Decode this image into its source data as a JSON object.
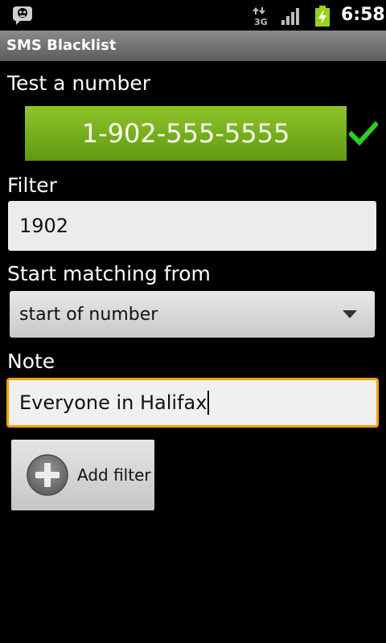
{
  "status_bar": {
    "time": "6:58",
    "network_type": "3G",
    "icons": [
      "app-notification-icon",
      "network-3g-icon",
      "signal-icon",
      "battery-charging-icon"
    ]
  },
  "app": {
    "title": "SMS Blacklist"
  },
  "test_number": {
    "label": "Test a number",
    "value": "1-902-555-5555",
    "status_icon": "checkmark-icon",
    "accent_color": "#7cb91f",
    "check_color": "#2ad31a"
  },
  "filter": {
    "label": "Filter",
    "value": "1902"
  },
  "match_from": {
    "label": "Start matching from",
    "selected": "start of number"
  },
  "note": {
    "label": "Note",
    "value": "Everyone in Halifax",
    "focus_color": "#f5a200"
  },
  "actions": {
    "add_filter_label": "Add filter"
  }
}
